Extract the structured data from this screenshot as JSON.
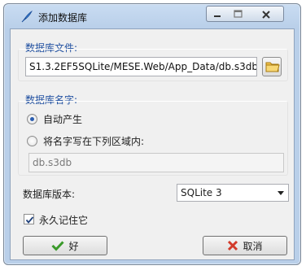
{
  "window": {
    "title": "添加数据库",
    "controls": {
      "minimize": "minimize-icon",
      "maximize": "maximize-icon",
      "close": "close-icon"
    }
  },
  "db_file": {
    "label": "数据库文件:",
    "value": "S1.3.2EF5SQLite/MESE.Web/App_Data/db.s3db",
    "browse_icon": "folder-icon"
  },
  "db_name": {
    "label": "数据库名字:",
    "options": [
      "自动产生",
      "将名字写在下列区域内:"
    ],
    "selected": "自动产生",
    "placeholder": "db.s3db"
  },
  "db_version": {
    "label": "数据库版本:",
    "selected": "SQLite 3"
  },
  "remember": {
    "label": "永久记住它",
    "checked": true
  },
  "buttons": {
    "ok": "好",
    "cancel": "取消"
  },
  "colors": {
    "group_title": "#1f4fa0",
    "frame": "#b9cfe9",
    "ok_check": "#3a9a2a",
    "cancel_x": "#d23a2a"
  }
}
